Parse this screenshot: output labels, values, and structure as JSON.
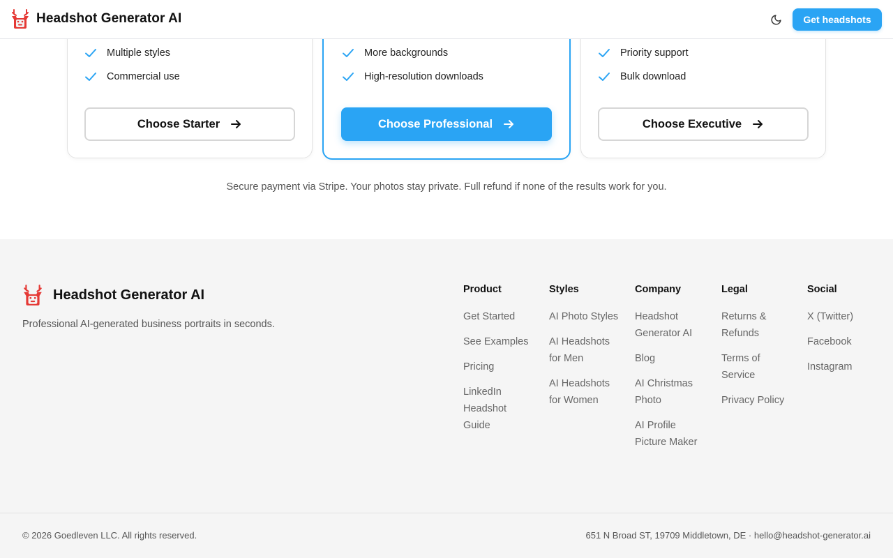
{
  "header": {
    "brand_name": "Headshot Generator AI",
    "theme_toggle_icon": "moon-icon",
    "cta_label": "Get headshots"
  },
  "plans": [
    {
      "features": [
        "Multiple styles",
        "Commercial use"
      ],
      "button_label": "Choose Starter",
      "featured": false
    },
    {
      "features": [
        "More backgrounds",
        "High-resolution downloads"
      ],
      "button_label": "Choose Professional",
      "featured": true
    },
    {
      "features": [
        "Priority support",
        "Bulk download"
      ],
      "button_label": "Choose Executive",
      "featured": false
    }
  ],
  "secure_note": "Secure payment via Stripe. Your photos stay private. Full refund if none of the results work for you.",
  "footer": {
    "brand_name": "Headshot Generator AI",
    "tagline": "Professional AI-generated business portraits in seconds.",
    "columns": [
      {
        "heading": "Product",
        "links": [
          "Get Started",
          "See Examples",
          "Pricing",
          "LinkedIn Headshot Guide"
        ]
      },
      {
        "heading": "Styles",
        "links": [
          "AI Photo Styles",
          "AI Headshots for Men",
          "AI Headshots for Women"
        ]
      },
      {
        "heading": "Company",
        "links": [
          "Headshot Generator AI",
          "Blog",
          "AI Christmas Photo",
          "AI Profile Picture Maker"
        ]
      },
      {
        "heading": "Legal",
        "links": [
          "Returns & Refunds",
          "Terms of Service",
          "Privacy Policy"
        ]
      },
      {
        "heading": "Social",
        "links": [
          "X (Twitter)",
          "Facebook",
          "Instagram"
        ]
      }
    ],
    "copyright": "© 2026 Goedleven LLC. All rights reserved.",
    "address": "651 N Broad ST, 19709 Middletown, DE · hello@headshot-generator.ai"
  },
  "colors": {
    "accent": "#2aa4f4",
    "logo_red": "#e53935",
    "footer_bg": "#f5f5f5"
  },
  "icons": {
    "logo": "deer-logo-icon",
    "check": "check-icon",
    "arrow": "arrow-right-icon"
  }
}
